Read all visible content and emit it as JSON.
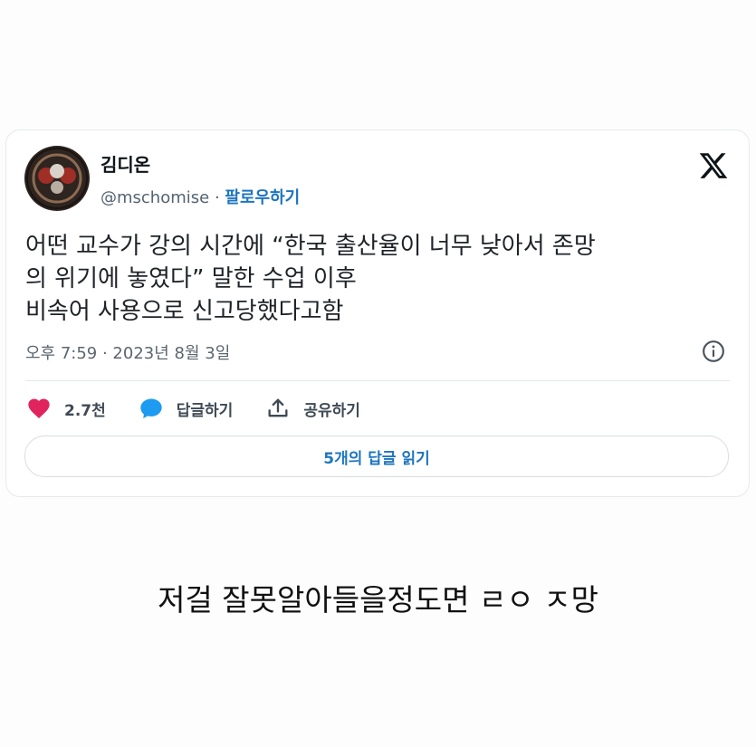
{
  "tweet": {
    "author_name": "김디온",
    "handle": "@mschomise",
    "separator": " · ",
    "follow_label": "팔로우하기",
    "text_lines": [
      "어떤 교수가 강의 시간에 “한국 출산율이 너무 낮아서 존망",
      "의 위기에 놓였다” 말한 수업 이후",
      "비속어 사용으로 신고당했다고함"
    ],
    "timestamp": "오후 7:59 · 2023년 8월 3일",
    "actions": {
      "like_count": "2.7천",
      "reply_label": "답글하기",
      "share_label": "공유하기"
    },
    "read_replies_label": "5개의 답글 읽기"
  },
  "caption": "저걸 잘못알아들을정도면 ㄹㅇ ㅈ망",
  "colors": {
    "heart": "#e0245e",
    "reply_bubble": "#1d9bf0",
    "link_blue": "#1d75bf"
  },
  "icons": {
    "logo": "x-logo-icon",
    "info": "info-icon",
    "like": "heart-icon",
    "reply": "speech-bubble-icon",
    "share": "share-upload-icon"
  }
}
